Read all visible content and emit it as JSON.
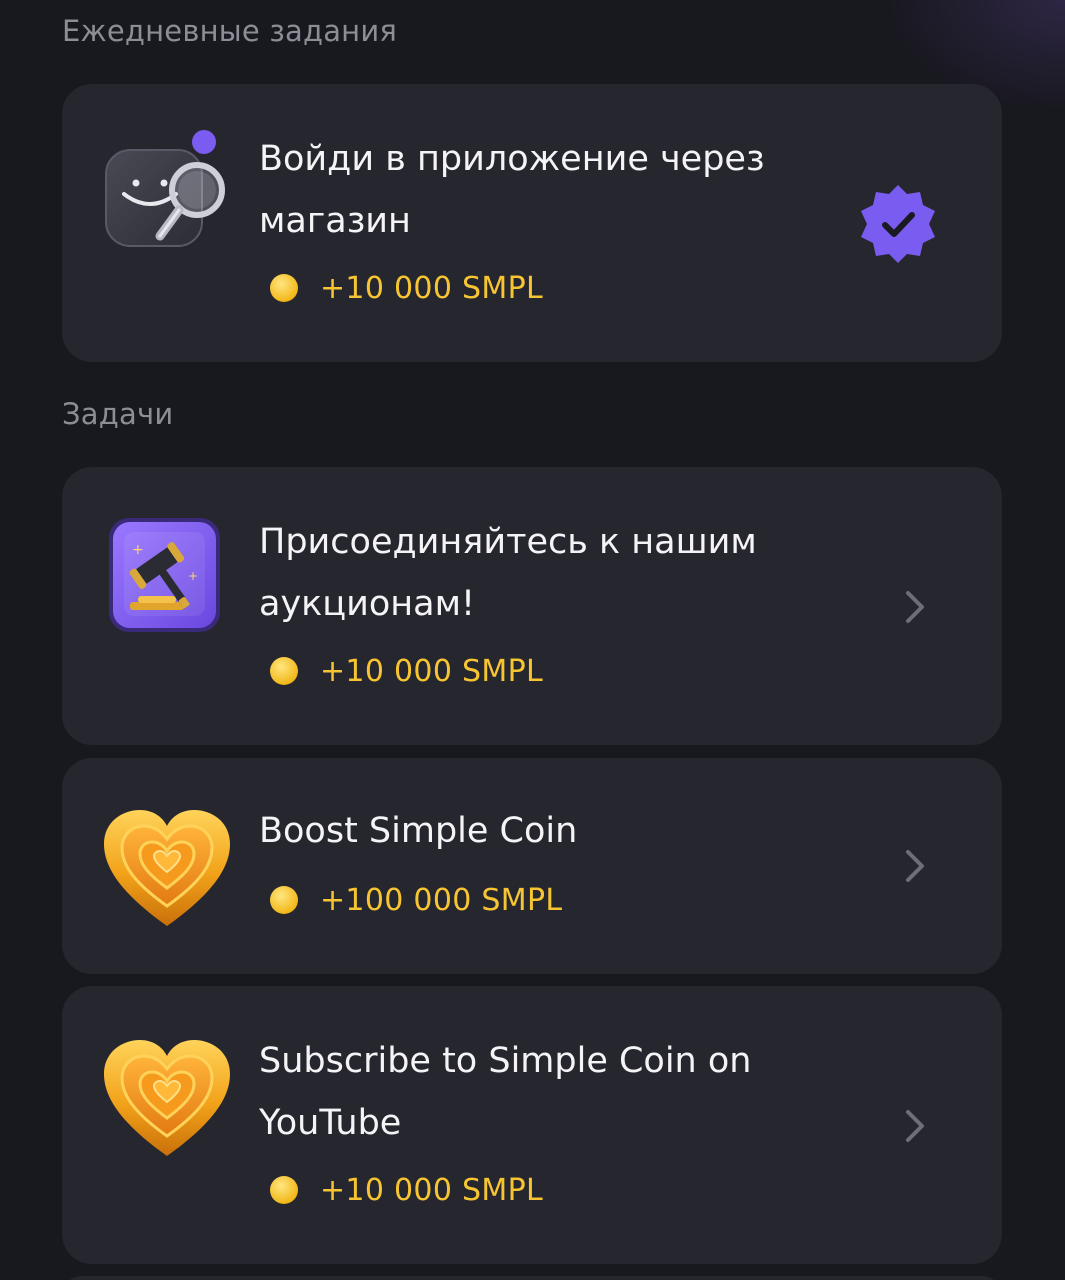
{
  "sections": {
    "daily_title": "Ежедневные задания",
    "tasks_title": "Задачи"
  },
  "cards": [
    {
      "title_line1": "Войди в приложение через",
      "title_line2": "магазин",
      "reward": "+10 000 SMPL",
      "icon": "smiley-magnifier-icon",
      "status": "completed-check-badge-icon"
    },
    {
      "title_line1": "Присоединяйтесь к нашим",
      "title_line2": "аукционам!",
      "reward": "+10 000 SMPL",
      "icon": "auction-gavel-icon",
      "status": "chevron-right-icon"
    },
    {
      "title_line1": "Boost Simple Coin",
      "reward": "+100 000 SMPL",
      "icon": "golden-heart-icon",
      "status": "chevron-right-icon"
    },
    {
      "title_line1": "Subscribe to Simple Coin on",
      "title_line2": "YouTube",
      "reward": "+10 000 SMPL",
      "icon": "golden-heart-icon",
      "status": "chevron-right-icon"
    }
  ],
  "colors": {
    "background": "#18181f",
    "card": "#26262f",
    "accent_purple": "#7b5cf0",
    "reward_gold": "#f7c532",
    "section_title": "#8d8d97"
  }
}
